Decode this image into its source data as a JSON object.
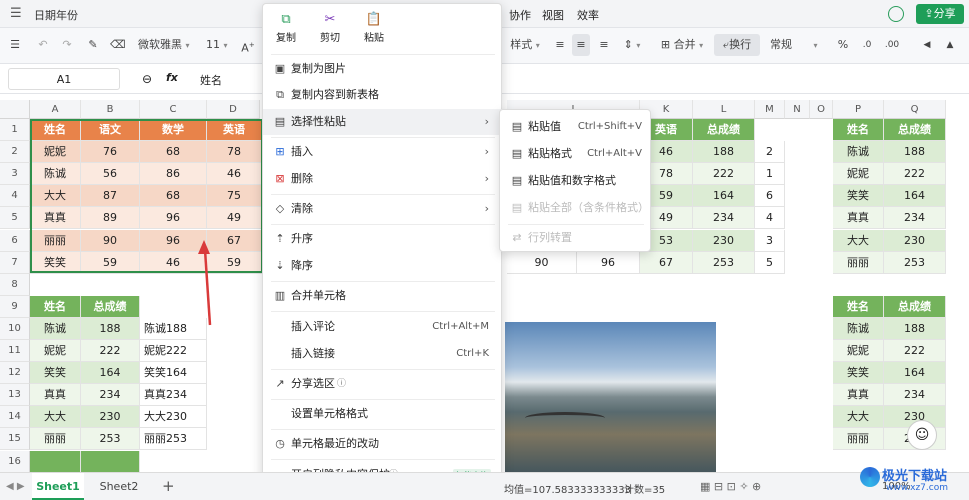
{
  "titlebar": {
    "doc_title": "日期年份",
    "menu": [
      "协作",
      "视图",
      "效率"
    ],
    "share_label": "分享"
  },
  "ribbon": {
    "font_name": "微软雅黑",
    "font_size": "11",
    "style_label": "样式",
    "merge_label": "合并",
    "wrap_label": "换行",
    "format_label": "常规"
  },
  "formula": {
    "cell_ref": "A1",
    "fx": "fx",
    "content": "姓名"
  },
  "columns": [
    "A",
    "B",
    "C",
    "D",
    "",
    "",
    "",
    "",
    "",
    "J",
    "K",
    "L",
    "M",
    "N",
    "O",
    "P",
    "Q"
  ],
  "rows": [
    "1",
    "2",
    "3",
    "4",
    "5",
    "6",
    "7",
    "8",
    "9",
    "10",
    "11",
    "12",
    "13",
    "14",
    "15",
    "16"
  ],
  "table1": {
    "headers": [
      "姓名",
      "语文",
      "数学",
      "英语"
    ],
    "rows": [
      [
        "妮妮",
        "76",
        "68",
        "78"
      ],
      [
        "陈诚",
        "56",
        "86",
        "46"
      ],
      [
        "大大",
        "87",
        "68",
        "75"
      ],
      [
        "真真",
        "89",
        "96",
        "49"
      ],
      [
        "丽丽",
        "90",
        "96",
        "67"
      ],
      [
        "笑笑",
        "59",
        "46",
        "59"
      ]
    ]
  },
  "table1_right": {
    "headers": [
      "英语",
      "总成绩"
    ],
    "rows": [
      [
        "46",
        "188",
        "2"
      ],
      [
        "78",
        "222",
        "1"
      ],
      [
        "59",
        "164",
        "6"
      ],
      [
        "49",
        "234",
        "4"
      ],
      [
        "53",
        "230",
        "3"
      ],
      [
        "67",
        "253",
        "5"
      ]
    ],
    "row7_extra": [
      "90",
      "96"
    ]
  },
  "table2": {
    "headers": [
      "姓名",
      "总成绩"
    ],
    "rows": [
      [
        "陈诚",
        "188"
      ],
      [
        "妮妮",
        "222"
      ],
      [
        "笑笑",
        "164"
      ],
      [
        "真真",
        "234"
      ],
      [
        "大大",
        "230"
      ],
      [
        "丽丽",
        "253"
      ]
    ]
  },
  "concat": [
    "陈诚188",
    "妮妮222",
    "笑笑164",
    "真真234",
    "大大230",
    "丽丽253"
  ],
  "table3": {
    "headers": [
      "姓名",
      "总成绩"
    ],
    "rows": [
      [
        "陈诚",
        "188"
      ],
      [
        "妮妮",
        "222"
      ],
      [
        "笑笑",
        "164"
      ],
      [
        "真真",
        "234"
      ],
      [
        "大大",
        "230"
      ],
      [
        "丽丽",
        "253"
      ]
    ]
  },
  "table4": {
    "headers": [
      "姓名",
      "总成绩"
    ],
    "rows": [
      [
        "陈诚",
        "188"
      ],
      [
        "妮妮",
        "222"
      ],
      [
        "笑笑",
        "164"
      ],
      [
        "真真",
        "234"
      ],
      [
        "大大",
        "230"
      ],
      [
        "丽丽",
        "253"
      ]
    ]
  },
  "context_menu": {
    "top": {
      "copy": "复制",
      "cut": "剪切",
      "paste": "粘贴"
    },
    "items": {
      "copy_as_image": "复制为图片",
      "copy_to_new_sheet": "复制内容到新表格",
      "paste_special": "选择性粘贴",
      "insert": "插入",
      "delete": "删除",
      "clear": "清除",
      "sort_asc": "升序",
      "sort_desc": "降序",
      "merge_cells": "合并单元格",
      "insert_comment": "插入评论",
      "insert_comment_sc": "Ctrl+Alt+M",
      "insert_link": "插入链接",
      "insert_link_sc": "Ctrl+K",
      "share_selection": "分享选区",
      "cell_format": "设置单元格格式",
      "recent_changes": "单元格最近的改动",
      "privacy": "开启列隐私内容保护",
      "privacy_badge": "智能表格"
    }
  },
  "submenu": {
    "paste_values": "粘贴值",
    "paste_values_sc": "Ctrl+Shift+V",
    "paste_format": "粘贴格式",
    "paste_format_sc": "Ctrl+Alt+V",
    "paste_values_num": "粘贴值和数字格式",
    "paste_all": "粘贴全部（含条件格式）",
    "transpose": "行列转置"
  },
  "status": {
    "sheet1": "Sheet1",
    "sheet2": "Sheet2",
    "sum_label": "均值=107.583333333333",
    "count_label": "计数=35",
    "zoom": "100%",
    "watermark": "极光下载站",
    "watermark_url": "www.xz7.com"
  },
  "colors": {
    "header_orange": "#e8834a",
    "header_green": "#74b35c",
    "share_green": "#1e9e58"
  }
}
